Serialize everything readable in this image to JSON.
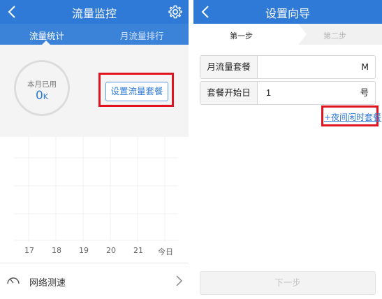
{
  "left": {
    "header": {
      "title": "流量监控"
    },
    "tabs": [
      {
        "label": "流量统计",
        "active": true
      },
      {
        "label": "月流量排行",
        "active": false
      }
    ],
    "usage": {
      "label": "本月已用",
      "value": "0",
      "unit": "K"
    },
    "set_plan_button": "设置流量套餐",
    "chart_days": [
      "17",
      "18",
      "19",
      "20",
      "21",
      "今日"
    ],
    "speed_test": {
      "label": "网络测速"
    }
  },
  "right": {
    "header": {
      "title": "设置向导"
    },
    "steps": [
      "第一步",
      "第二步"
    ],
    "fields": [
      {
        "label": "月流量套餐",
        "value": "",
        "suffix": "M"
      },
      {
        "label": "套餐开始日",
        "value": "1",
        "suffix": "号"
      }
    ],
    "night_plan_link": "+夜间闲时套餐",
    "next_button": "下一步"
  },
  "colors": {
    "header_blue": "#2f7ad6",
    "highlight_red": "#e0141e"
  }
}
